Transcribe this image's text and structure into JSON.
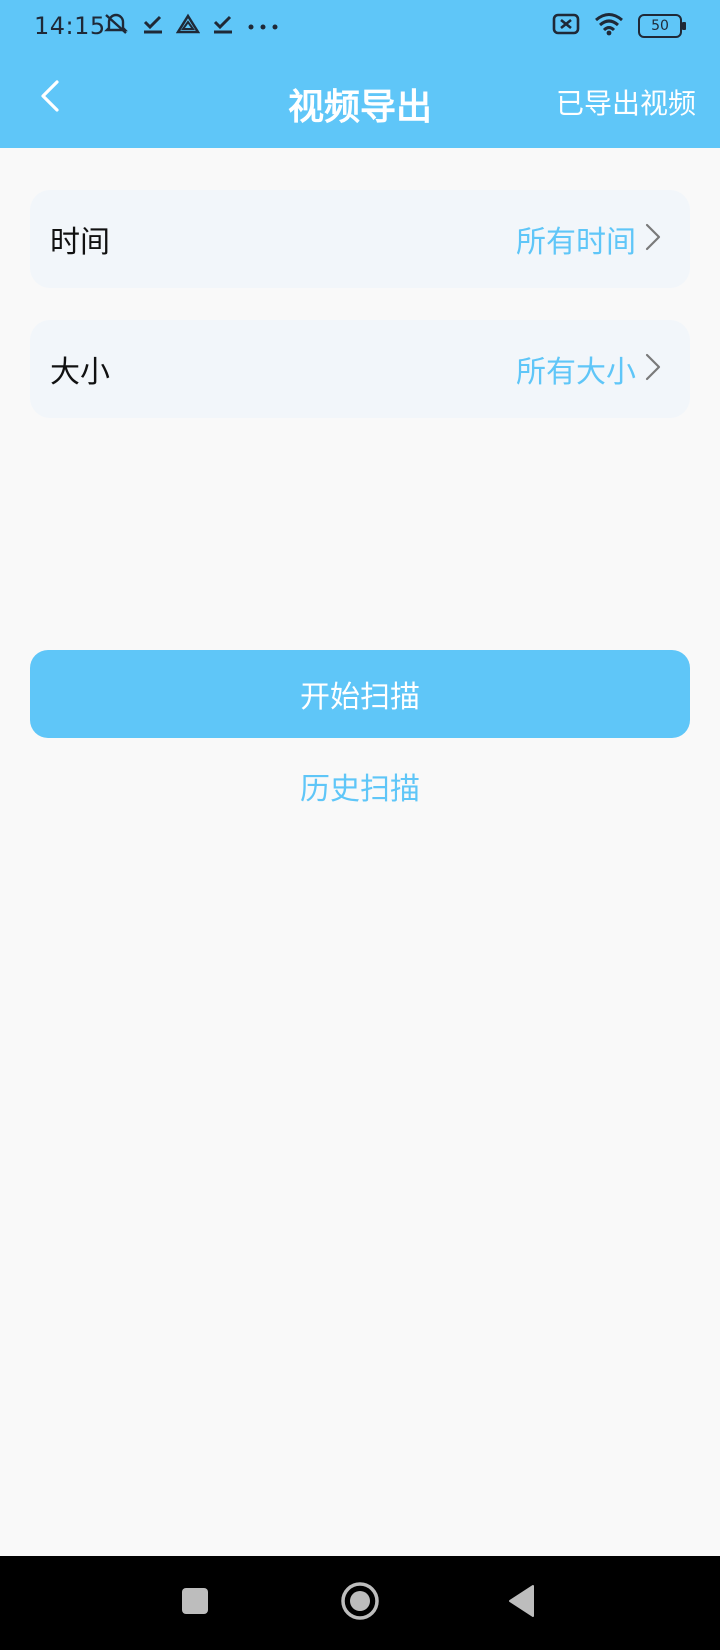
{
  "status_bar": {
    "time": "14:15",
    "battery_level": "50",
    "icons_left": [
      "mute-icon",
      "check-icon",
      "drive-icon",
      "check-icon",
      "more-icon"
    ],
    "icons_right": [
      "x-box-icon",
      "wifi-icon",
      "battery-icon"
    ]
  },
  "app_bar": {
    "title": "视频导出",
    "right_action": "已导出视频",
    "back_icon": "chevron-left-icon"
  },
  "filters": [
    {
      "label": "时间",
      "value": "所有时间"
    },
    {
      "label": "大小",
      "value": "所有大小"
    }
  ],
  "actions": {
    "primary": "开始扫描",
    "secondary": "历史扫描"
  },
  "colors": {
    "accent": "#5fc6f8",
    "card_bg": "#f2f6fa",
    "page_bg": "#f9f9f9"
  },
  "nav_bar": {
    "icons": [
      "square-icon",
      "home-circle-icon",
      "back-triangle-icon"
    ]
  }
}
